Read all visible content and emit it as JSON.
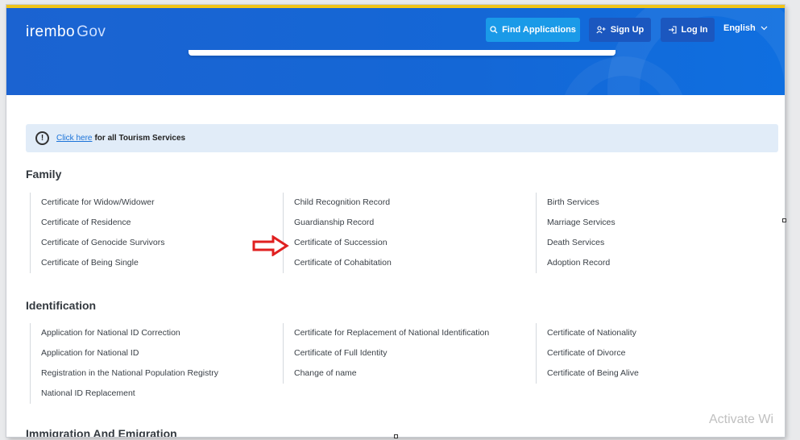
{
  "header": {
    "logo_main": "irembo",
    "logo_suffix": "Gov",
    "find_applications": "Find Applications",
    "sign_up": "Sign Up",
    "log_in": "Log In",
    "language": "English"
  },
  "notice": {
    "link_text": "Click here",
    "rest_text": "for all Tourism Services"
  },
  "sections": {
    "family": {
      "title": "Family",
      "col1": [
        "Certificate for Widow/Widower",
        "Certificate of Residence",
        "Certificate of Genocide Survivors",
        "Certificate of Being Single"
      ],
      "col2": [
        "Child Recognition Record",
        "Guardianship Record",
        "Certificate of Succession",
        "Certificate of Cohabitation"
      ],
      "col3": [
        "Birth Services",
        "Marriage Services",
        "Death Services",
        "Adoption Record"
      ]
    },
    "identification": {
      "title": "Identification",
      "col1": [
        "Application for National ID Correction",
        "Application for National ID",
        "Registration in the National Population Registry",
        "National ID Replacement"
      ],
      "col2": [
        "Certificate for Replacement of National Identification",
        "Certificate of Full Identity",
        "Change of name"
      ],
      "col3": [
        "Certificate of Nationality",
        "Certificate of Divorce",
        "Certificate of Being Alive"
      ]
    },
    "immigration": {
      "title": "Immigration And Emigration"
    }
  },
  "watermark": "Activate Wi",
  "colors": {
    "hero_blue": "#1467d6",
    "find_button": "#1a9ae8",
    "link_blue": "#1b73d9",
    "arrow_red": "#e02020"
  }
}
